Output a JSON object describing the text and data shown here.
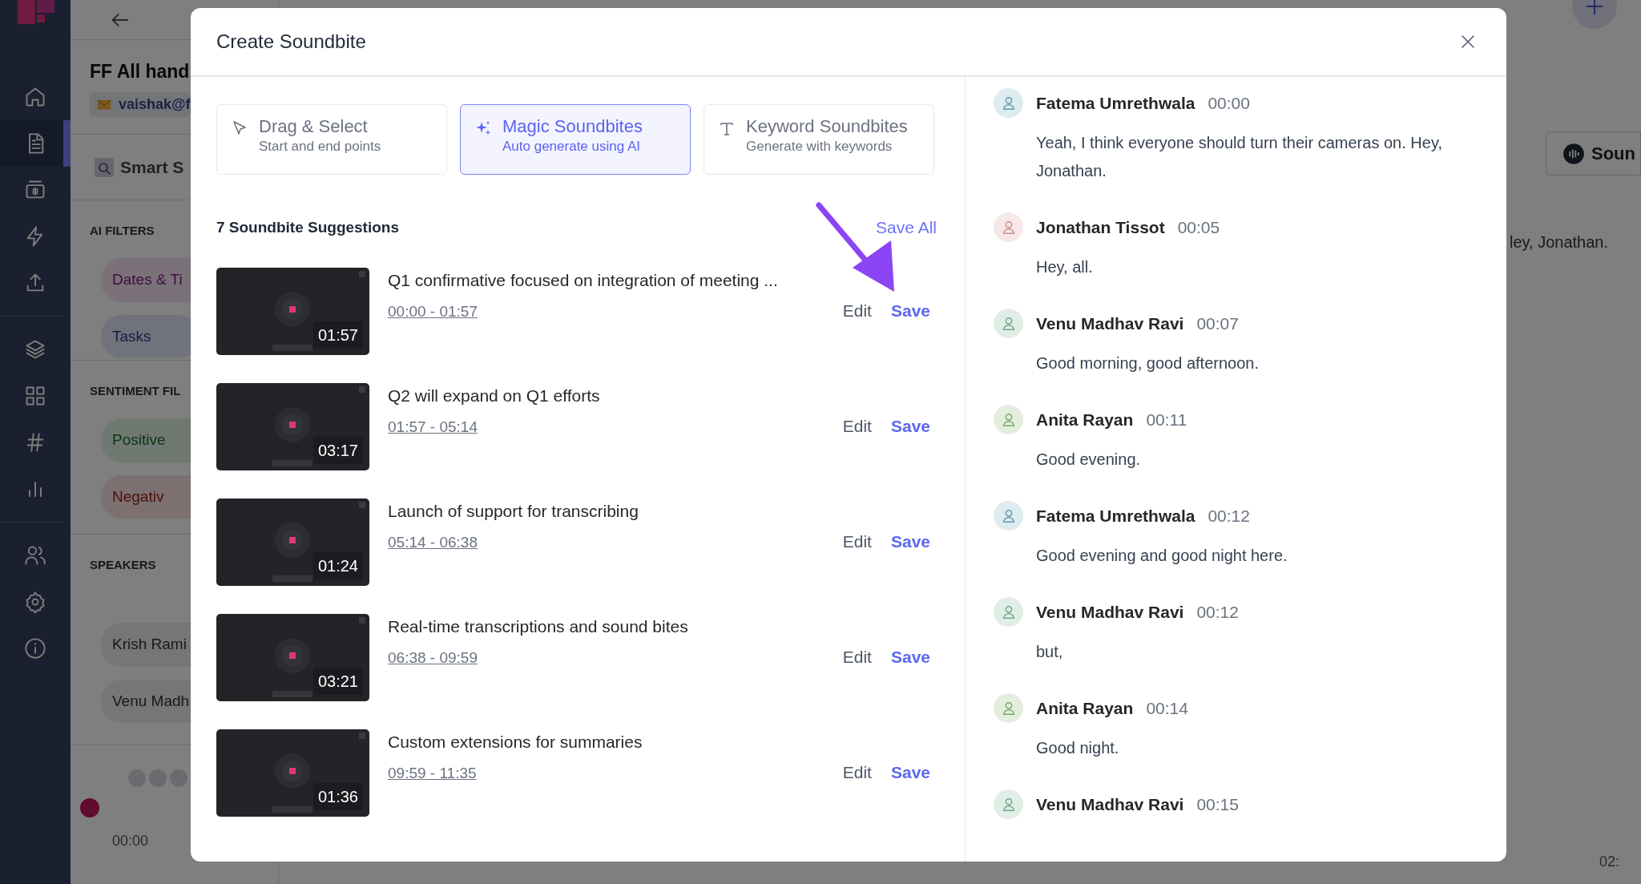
{
  "sidebar": {
    "groups": [
      [
        {
          "selected": false
        },
        {
          "selected": true
        },
        {
          "selected": false
        },
        {
          "selected": false
        },
        {
          "selected": false
        }
      ],
      [
        {
          "selected": false
        },
        {
          "selected": false
        },
        {
          "selected": false
        },
        {
          "selected": false
        }
      ],
      [
        {
          "selected": false
        },
        {
          "selected": false
        },
        {
          "selected": false
        }
      ]
    ]
  },
  "background": {
    "title": "FF All hand",
    "owner": "vaishak@f",
    "search_label": "Smart S",
    "filter_sections": [
      {
        "heading": "AI FILTERS",
        "pills": [
          {
            "label": "Dates & Ti",
            "kind": "date"
          },
          {
            "label": "Tasks",
            "kind": "task"
          }
        ]
      },
      {
        "heading": "SENTIMENT FIL",
        "pills": [
          {
            "label": "Positive",
            "kind": "positive"
          },
          {
            "label": "Negativ",
            "kind": "negative"
          }
        ]
      },
      {
        "heading": "SPEAKERS",
        "pills": [
          {
            "label": "Krish Rami",
            "kind": "speaker"
          },
          {
            "label": "Venu Madh",
            "kind": "speaker"
          }
        ]
      }
    ],
    "start_time": "00:00",
    "end_time": "02:",
    "sound_button": "Soun",
    "transcript_fragment": "ley, Jonathan."
  },
  "modal": {
    "title": "Create Soundbite",
    "tabs": [
      {
        "title": "Drag & Select",
        "subtitle": "Start and end points",
        "selected": false
      },
      {
        "title": "Magic Soundbites",
        "subtitle": "Auto generate using AI",
        "selected": true
      },
      {
        "title": "Keyword Soundbites",
        "subtitle": "Generate with keywords",
        "selected": false
      }
    ],
    "suggestions_heading": "7 Soundbite Suggestions",
    "save_all": "Save All",
    "suggestions": [
      {
        "title": "Q1 confirmative focused on integration of meeting ...",
        "range": "00:00 - 01:57",
        "duration": "01:57",
        "edit": "Edit",
        "save": "Save"
      },
      {
        "title": "Q2 will expand on Q1 efforts",
        "range": "01:57 - 05:14",
        "duration": "03:17",
        "edit": "Edit",
        "save": "Save"
      },
      {
        "title": "Launch of support for transcribing",
        "range": "05:14 - 06:38",
        "duration": "01:24",
        "edit": "Edit",
        "save": "Save"
      },
      {
        "title": "Real-time transcriptions and sound bites",
        "range": "06:38 - 09:59",
        "duration": "03:21",
        "edit": "Edit",
        "save": "Save"
      },
      {
        "title": "Custom extensions for summaries",
        "range": "09:59 - 11:35",
        "duration": "01:36",
        "edit": "Edit",
        "save": "Save"
      }
    ],
    "transcript": [
      {
        "speaker": "Fatema Umrethwala",
        "time": "00:00",
        "text": "Yeah, I think everyone should turn their cameras on. Hey, Jonathan.",
        "color": "#5b9bb0"
      },
      {
        "speaker": "Jonathan Tissot",
        "time": "00:05",
        "text": "Hey, all.",
        "color": "#d08a8a"
      },
      {
        "speaker": "Venu Madhav Ravi",
        "time": "00:07",
        "text": "Good morning, good afternoon.",
        "color": "#6aab85"
      },
      {
        "speaker": "Anita Rayan",
        "time": "00:11",
        "text": "Good evening.",
        "color": "#7aab5a"
      },
      {
        "speaker": "Fatema Umrethwala",
        "time": "00:12",
        "text": "Good evening and good night here.",
        "color": "#5b9bb0"
      },
      {
        "speaker": "Venu Madhav Ravi",
        "time": "00:12",
        "text": "but,",
        "color": "#6aab85"
      },
      {
        "speaker": "Anita Rayan",
        "time": "00:14",
        "text": "Good night.",
        "color": "#7aab5a"
      },
      {
        "speaker": "Venu Madhav Ravi",
        "time": "00:15",
        "color": "#6aab85"
      }
    ]
  }
}
